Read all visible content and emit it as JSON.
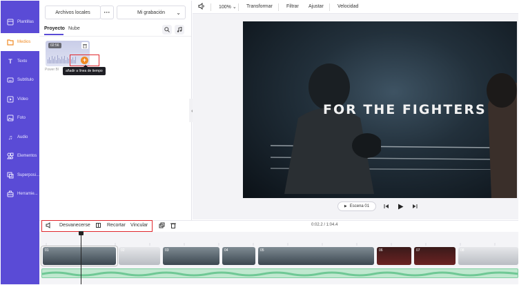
{
  "sidebar": {
    "items": [
      {
        "label": "Plantillas",
        "icon": "template-icon"
      },
      {
        "label": "Medios",
        "icon": "folder-icon",
        "active": true
      },
      {
        "label": "Texto",
        "icon": "text-icon"
      },
      {
        "label": "Subtítulo",
        "icon": "subtitle-icon"
      },
      {
        "label": "Vídeo",
        "icon": "video-icon"
      },
      {
        "label": "Foto",
        "icon": "photo-icon"
      },
      {
        "label": "Audio",
        "icon": "music-icon"
      },
      {
        "label": "Elementos",
        "icon": "elements-icon"
      },
      {
        "label": "Superposi...",
        "icon": "overlay-icon"
      },
      {
        "label": "Herramie...",
        "icon": "toolbox-icon"
      }
    ]
  },
  "panel": {
    "local_files": "Archivos locales",
    "more": "···",
    "recording": "Mi grabación",
    "tabs": [
      "Proyecto",
      "Nube"
    ],
    "media": {
      "duration": "02:56",
      "label": "Power Bl",
      "add_tooltip": "añadir a línea de tiempo"
    }
  },
  "toolbar": {
    "zoom": "100%",
    "transform": "Transformar",
    "filter": "Filtrar",
    "adjust": "Ajustar",
    "speed": "Velocidad"
  },
  "preview": {
    "title": "FOR THE FIGHTERS",
    "scene": "Escena 01"
  },
  "timeline": {
    "fade": "Desvanecerse",
    "crop": "Recortar",
    "link": "Vincular",
    "time": "0:02.2 / 1:04.4",
    "clips": [
      "01",
      "02",
      "03",
      "04",
      "05",
      "06",
      "07",
      "08"
    ]
  },
  "colors": {
    "sidebar": "#5a4bd6",
    "accent": "#f08a24",
    "highlight": "#e0262b"
  }
}
